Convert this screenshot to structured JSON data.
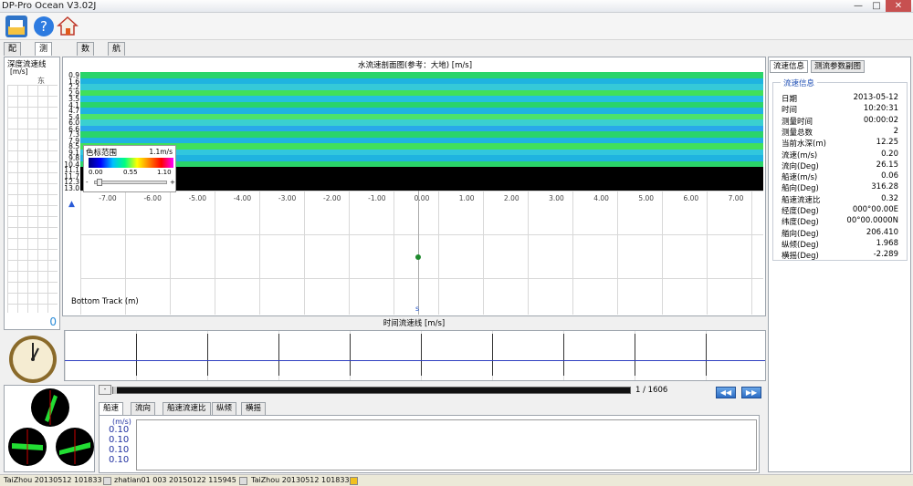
{
  "window": {
    "title": "DP-Pro Ocean V3.02J"
  },
  "toolbar": {
    "icons": [
      "open-icon",
      "help-icon",
      "home-icon"
    ]
  },
  "main_tabs": [
    {
      "label": "配置"
    },
    {
      "label": "测流控制",
      "active": true
    },
    {
      "label": "数据"
    },
    {
      "label": "航迹"
    }
  ],
  "depth_panel": {
    "title": "深度流速线",
    "unit": "[m/s]",
    "direction": "东",
    "value": "0"
  },
  "velocity_section": {
    "title": "水流速剖面图(参考：大地) [m/s]",
    "depths": [
      "0.9",
      "1.6",
      "2.2",
      "2.9",
      "3.5",
      "4.1",
      "4.7",
      "5.4",
      "6.0",
      "6.6",
      "7.3",
      "7.9",
      "8.5",
      "9.1",
      "9.8",
      "10.4",
      "11.1",
      "11.7",
      "12.3",
      "13.0"
    ],
    "x_ticks": [
      "-7.00",
      "-6.00",
      "-5.00",
      "-4.00",
      "-3.00",
      "-2.00",
      "-1.00",
      "0.00",
      "1.00",
      "2.00",
      "3.00",
      "4.00",
      "5.00",
      "6.00",
      "7.00"
    ],
    "bottom_track_label": "Bottom Track (m)",
    "s_label": "s",
    "colors": [
      "#2ad46a",
      "#1fb3e0",
      "#35c9d8",
      "#41e05a",
      "#24c0e0",
      "#2ad46a",
      "#1fb3e0",
      "#4ce36a",
      "#3ad0d0",
      "#29a8ea",
      "#2ad46a",
      "#1fb3e0",
      "#41e05a",
      "#31c7de",
      "#1fb3e0",
      "#2ad46a",
      "#000000",
      "#000000",
      "#000000",
      "#000000"
    ]
  },
  "color_scale": {
    "title": "色标范围",
    "value": "1.1m/s",
    "ticks": [
      "0.00",
      "0.55",
      "1.10"
    ],
    "minus": "-",
    "plus": "+"
  },
  "time_series": {
    "title": "时间流速线 [m/s]"
  },
  "playback": {
    "position": "1 / 1606",
    "rewind_label": "◀◀",
    "forward_label": "▶▶",
    "minus": "-"
  },
  "sub_tabs": [
    {
      "label": "船速",
      "active": true
    },
    {
      "label": "流向"
    },
    {
      "label": "船速流速比"
    },
    {
      "label": "纵倾"
    },
    {
      "label": "横摇"
    }
  ],
  "ship_speed": {
    "unit": "(m/s)",
    "values": [
      "0.10",
      "0.10",
      "0.10",
      "0.10"
    ]
  },
  "info_tabs": [
    {
      "label": "流速信息",
      "active": true
    },
    {
      "label": "测流参数副图"
    }
  ],
  "flow_info": {
    "group": "流速信息",
    "rows": [
      {
        "label": "日期",
        "value": "2013-05-12"
      },
      {
        "label": "时间",
        "value": "10:20:31"
      },
      {
        "label": "测量时间",
        "value": "00:00:02"
      },
      {
        "label": "测量总数",
        "value": "2"
      },
      {
        "label": "当前水深(m)",
        "value": "12.25"
      },
      {
        "label": "流速(m/s)",
        "value": "0.20"
      },
      {
        "label": "流向(Deg)",
        "value": "26.15"
      },
      {
        "label": "船速(m/s)",
        "value": "0.06"
      },
      {
        "label": "船向(Deg)",
        "value": "316.28"
      },
      {
        "label": "船速流速比",
        "value": "0.32"
      },
      {
        "label": "经度(Deg)",
        "value": "000°00.00E"
      },
      {
        "label": "纬度(Deg)",
        "value": "00°00.0000N"
      },
      {
        "label": "艏向(Deg)",
        "value": "206.410"
      },
      {
        "label": "纵倾(Deg)",
        "value": "1.968"
      },
      {
        "label": "横摇(Deg)",
        "value": "-2.289"
      }
    ]
  },
  "status_bar": {
    "items": [
      "TaiZhou 20130512 101833",
      "zhatian01 003 20150122 115945",
      "TaiZhou 20130512 101833"
    ]
  }
}
